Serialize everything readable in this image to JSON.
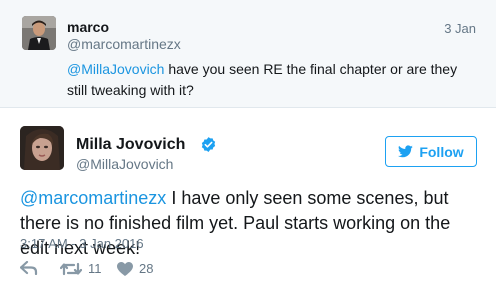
{
  "reply_tweet": {
    "name": "marco",
    "handle": "@marcomartinezx",
    "date": "3 Jan",
    "mention": "@MillaJovovich",
    "text": " have you seen RE the final chapter or are they still tweaking with it?"
  },
  "main_tweet": {
    "name": "Milla Jovovich",
    "handle": "@MillaJovovich",
    "follow_label": "Follow",
    "mention": "@marcomartinezx",
    "text": " I have only seen some scenes, but there is no finished film yet. Paul starts working on the edit next week!",
    "timestamp": "3:17 AM - 3 Jan 2016",
    "retweets": "11",
    "likes": "28"
  },
  "colors": {
    "accent": "#1da1f2",
    "mention": "#1b95e0",
    "muted": "#657786",
    "parent_bg": "#f5f8fa"
  },
  "icons": [
    "reply-icon",
    "retweet-icon",
    "like-icon",
    "verified-icon",
    "twitter-bird-icon"
  ]
}
